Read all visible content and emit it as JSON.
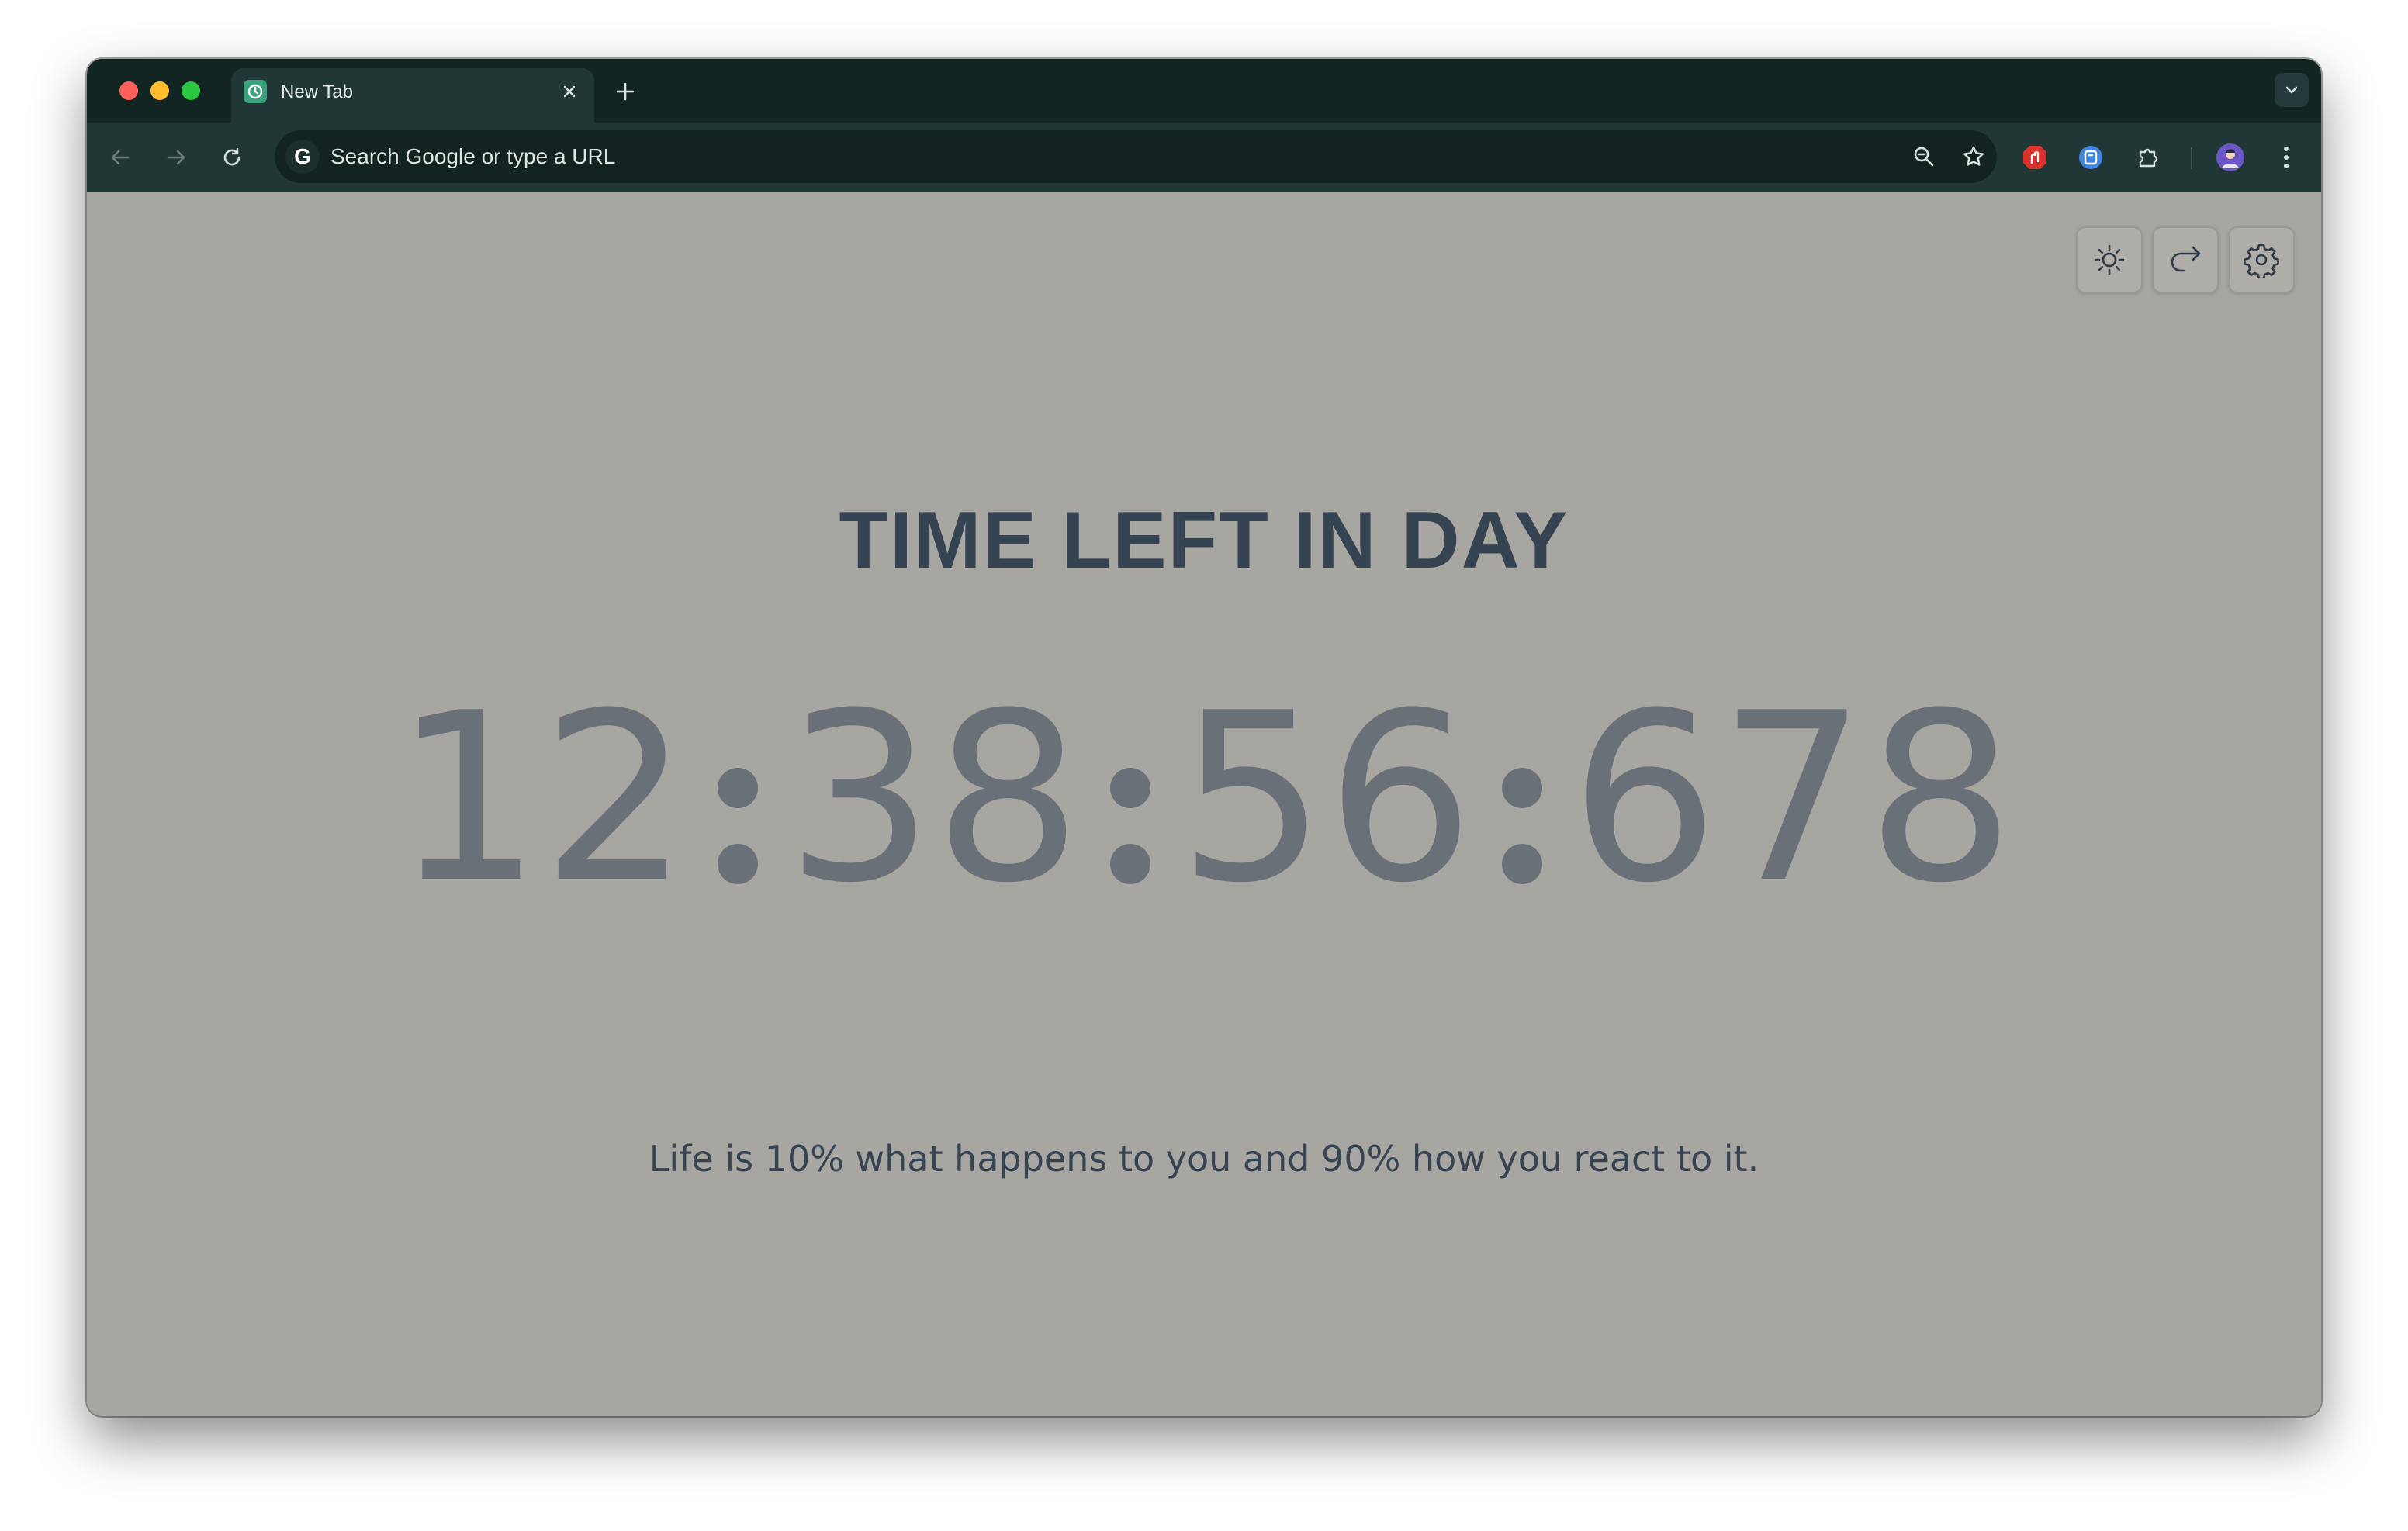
{
  "browser": {
    "tab": {
      "title": "New Tab",
      "favicon": "clock-icon"
    },
    "toolbar": {
      "omnibox_placeholder": "Search Google or type a URL",
      "icons": [
        "back-arrow-icon",
        "forward-arrow-icon",
        "reload-icon",
        "zoom-icon",
        "bookmark-star-icon",
        "adblock-extension-icon",
        "lastpass-extension-icon",
        "extensions-puzzle-icon",
        "profile-avatar",
        "kebab-menu-icon"
      ]
    }
  },
  "page": {
    "headline": "TIME LEFT IN DAY",
    "countdown": {
      "hours": "12",
      "minutes": "38",
      "seconds": "56",
      "milliseconds": "678"
    },
    "quote": "Life is 10% what happens to you and 90% how you react to it.",
    "controls": [
      "theme-toggle-sun-icon",
      "share-arrow-icon",
      "settings-gear-icon"
    ]
  },
  "colors": {
    "page_background": "#a7a6a1",
    "headline": "#364353",
    "countdown": "#6a7078",
    "chrome_frame": "#122523",
    "chrome_toolbar": "#203735"
  }
}
